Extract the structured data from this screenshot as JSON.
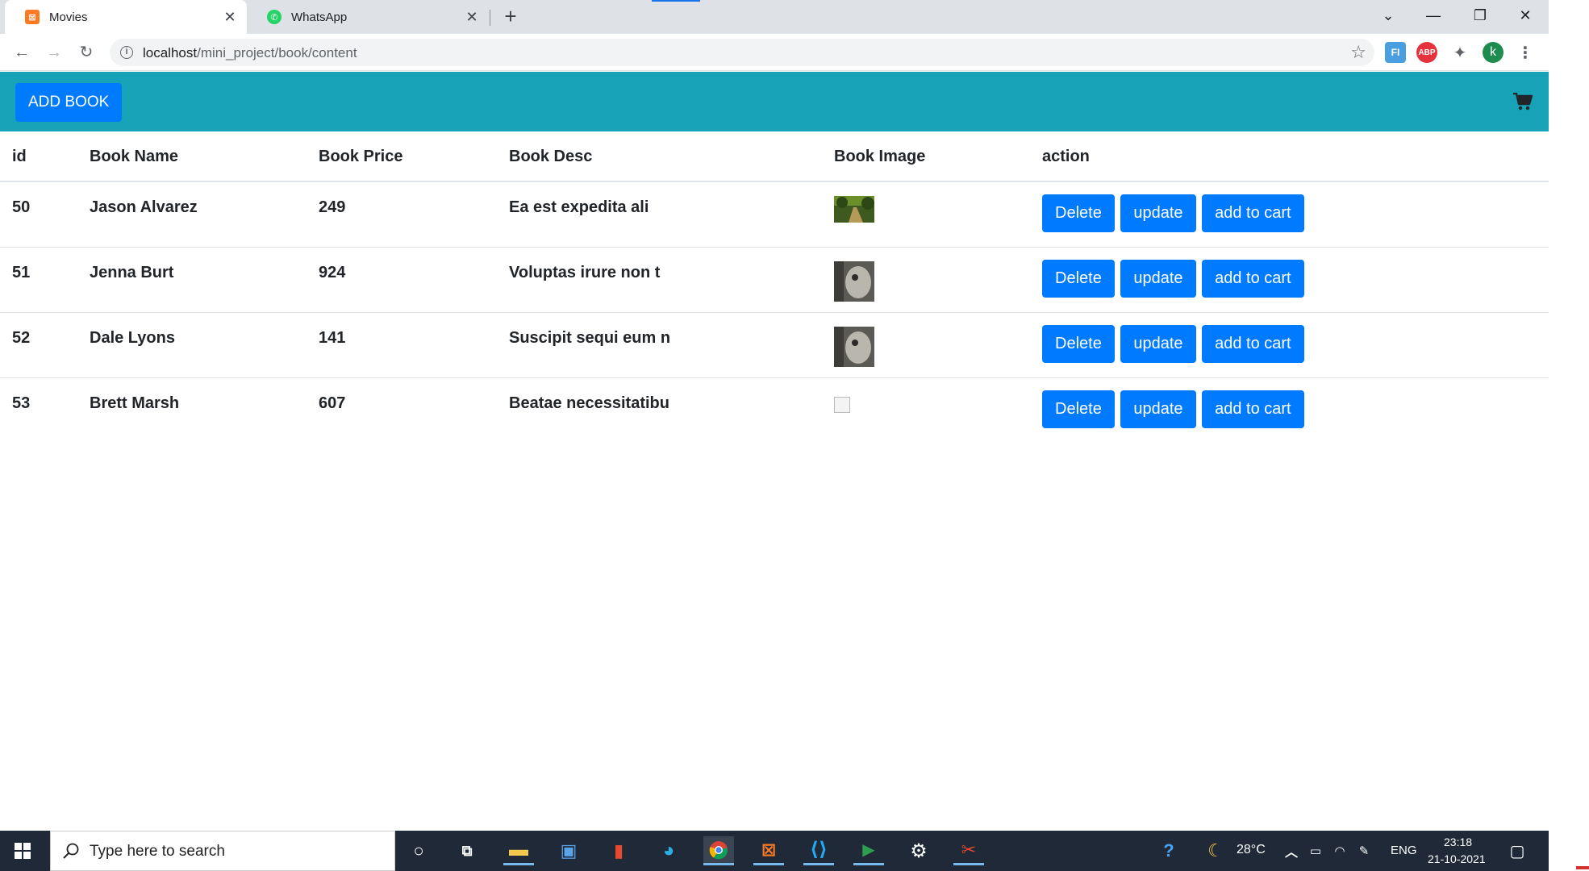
{
  "browser": {
    "tabs": [
      {
        "title": "Movies",
        "active": true
      },
      {
        "title": "WhatsApp",
        "active": false
      }
    ],
    "url_host": "localhost",
    "url_path": "/mini_project/book/content",
    "profile_initial": "k",
    "extensions": [
      "FI",
      "ABP"
    ]
  },
  "header": {
    "add_button_label": "ADD BOOK",
    "bg_color": "#17a2b8",
    "cart_icon": "shopping-cart-icon"
  },
  "table": {
    "columns": [
      "id",
      "Book Name",
      "Book Price",
      "Book Desc",
      "Book Image",
      "action"
    ],
    "rows": [
      {
        "id": "50",
        "name": "Jason Alvarez",
        "price": "249",
        "desc": "Ea est expedita ali",
        "image": "forest-path-photo"
      },
      {
        "id": "51",
        "name": "Jenna Burt",
        "price": "924",
        "desc": "Voluptas irure non t",
        "image": "owl-photo"
      },
      {
        "id": "52",
        "name": "Dale Lyons",
        "price": "141",
        "desc": "Suscipit sequi eum n",
        "image": "owl-photo"
      },
      {
        "id": "53",
        "name": "Brett Marsh",
        "price": "607",
        "desc": "Beatae necessitatibu",
        "image": "broken-image"
      }
    ],
    "actions": {
      "delete": "Delete",
      "update": "update",
      "add_to_cart": "add to cart"
    },
    "button_color": "#007bff"
  },
  "taskbar": {
    "search_placeholder": "Type here to search",
    "weather": "28°C",
    "language": "ENG",
    "time": "23:18",
    "date": "21-10-2021"
  }
}
